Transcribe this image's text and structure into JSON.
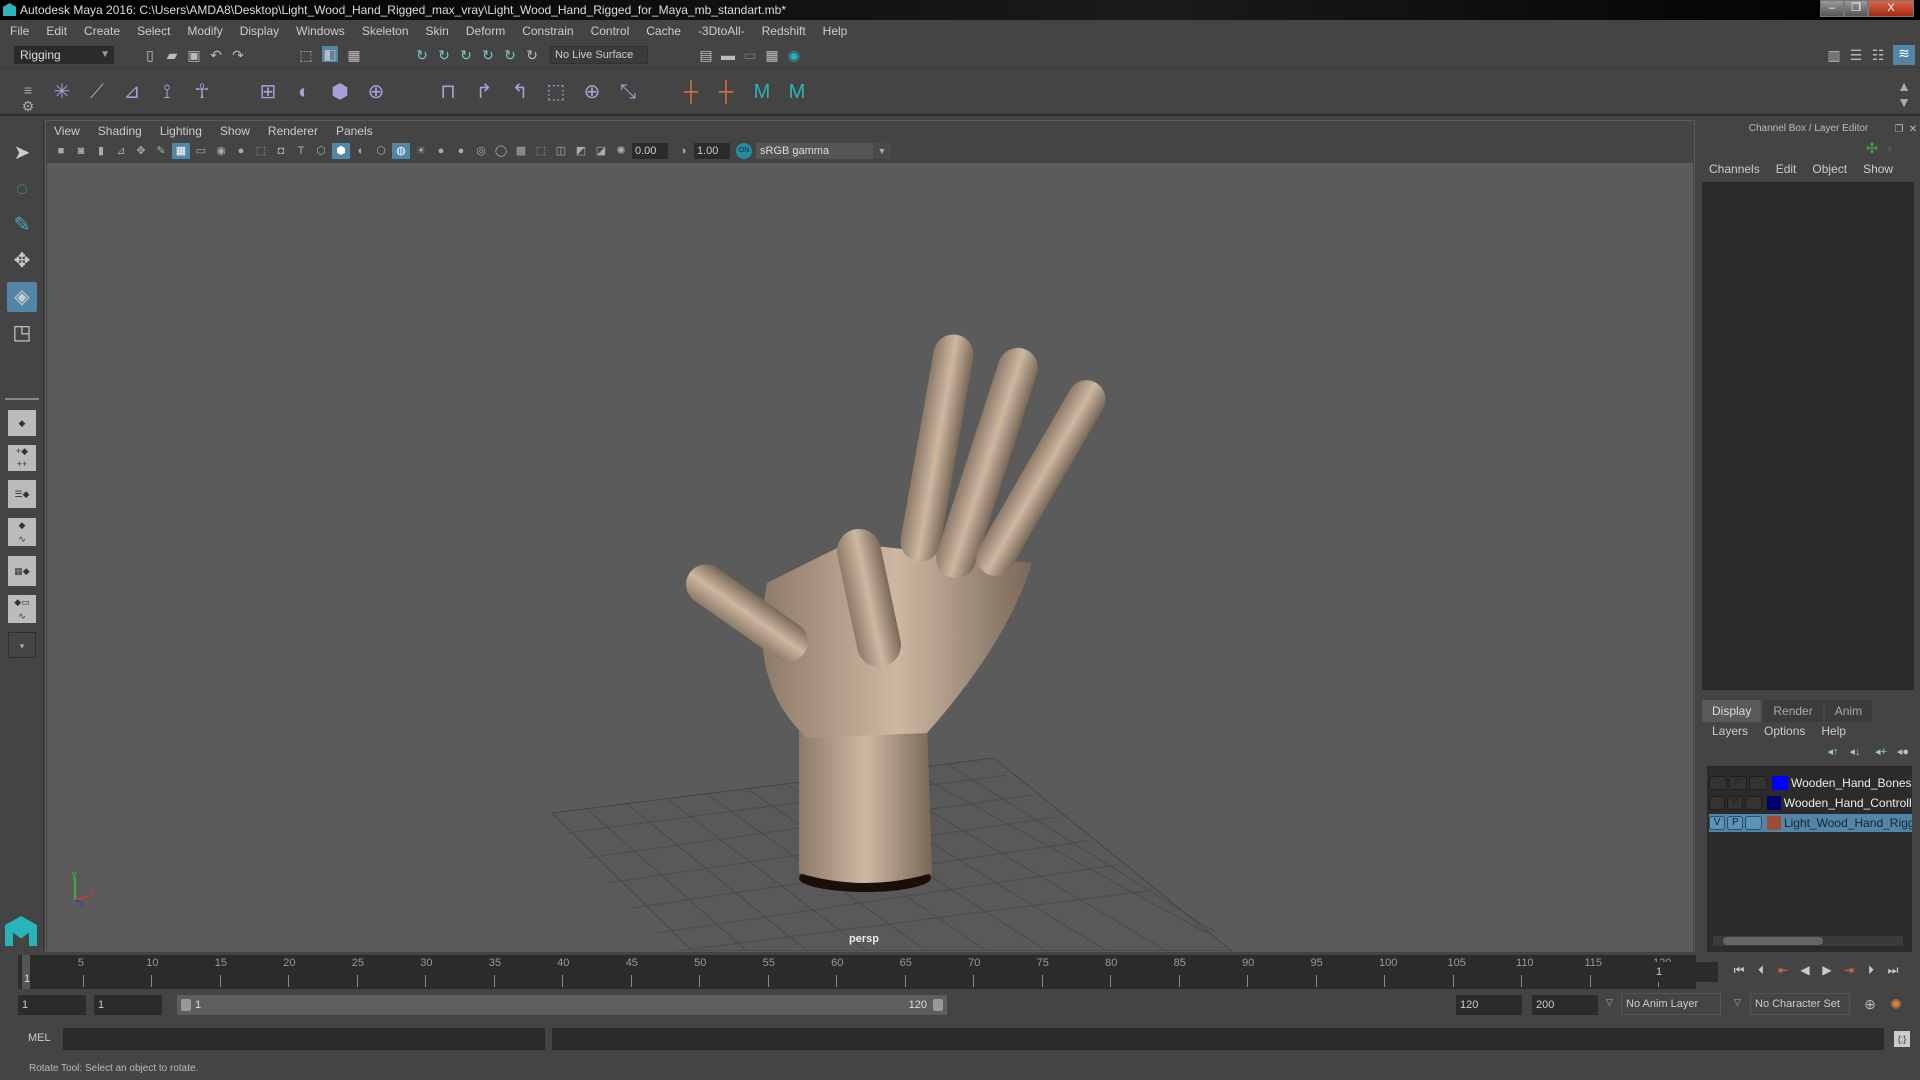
{
  "window": {
    "title": "Autodesk Maya 2016: C:\\Users\\AMDA8\\Desktop\\Light_Wood_Hand_Rigged_max_vray\\Light_Wood_Hand_Rigged_for_Maya_mb_standart.mb*",
    "buttons": {
      "minimize": "–",
      "restore": "❐",
      "close": "X"
    }
  },
  "menubar": [
    "File",
    "Edit",
    "Create",
    "Select",
    "Modify",
    "Display",
    "Windows",
    "Skeleton",
    "Skin",
    "Deform",
    "Constrain",
    "Control",
    "Cache",
    "-3DtoAll-",
    "Redshift",
    "Help"
  ],
  "status_toolbar": {
    "mode": "Rigging",
    "live_surface": "No Live Surface",
    "icons": [
      "new-scene-icon",
      "open-scene-icon",
      "save-scene-icon",
      "undo-icon",
      "redo-icon",
      "select-hierarchy-icon",
      "select-object-icon",
      "select-component-icon",
      "snap-grid-icon",
      "snap-curve-icon",
      "snap-point-icon",
      "snap-projected-center-icon",
      "snap-view-plane-icon",
      "snap-live-icon",
      "render-view-icon",
      "render-icon",
      "ipr-icon",
      "render-settings-icon",
      "hypershade-icon"
    ]
  },
  "shelf": {
    "icons": [
      "joint-tool-icon",
      "insert-joint-icon",
      "ik-handle-icon",
      "ik-spline-icon",
      "humanik-icon",
      "bind-skin-icon",
      "smooth-bind-icon",
      "lattice-icon",
      "cluster-icon",
      "parent-constraint-icon",
      "point-constraint-icon",
      "orient-constraint-icon",
      "scale-constraint-icon",
      "aim-constraint-icon",
      "pole-vector-icon",
      "locator-icon",
      "locator-link-icon",
      "maya-logo-icon",
      "maya-logo-alt-icon"
    ]
  },
  "tools": [
    "select-tool",
    "lasso-tool",
    "paint-select-tool",
    "move-tool",
    "rotate-tool",
    "scale-tool"
  ],
  "viewport": {
    "menu": [
      "View",
      "Shading",
      "Lighting",
      "Show",
      "Renderer",
      "Panels"
    ],
    "exposure": "0.00",
    "gamma": "1.00",
    "color_mgmt_toggle": "ON",
    "color_space": "sRGB gamma",
    "camera_label": "persp",
    "axis": {
      "y": "y",
      "x": "x",
      "z": "z"
    }
  },
  "channel_box": {
    "title": "Channel Box / Layer Editor",
    "menu": [
      "Channels",
      "Edit",
      "Object",
      "Show"
    ]
  },
  "layer_editor": {
    "tabs": [
      "Display",
      "Render",
      "Anim"
    ],
    "active_tab": "Display",
    "menu": [
      "Layers",
      "Options",
      "Help"
    ],
    "layers": [
      {
        "v": "",
        "p": "P",
        "t": "",
        "color": "#0000ff",
        "name": "Wooden_Hand_Bones",
        "selected": false
      },
      {
        "v": "",
        "p": "P",
        "t": "",
        "color": "#00006e",
        "name": "Wooden_Hand_Controllers",
        "selected": false
      },
      {
        "v": "V",
        "p": "P",
        "t": "",
        "color": "#a04a3a",
        "name": "Light_Wood_Hand_Rigged",
        "selected": true
      }
    ]
  },
  "timeline": {
    "ticks": [
      5,
      10,
      15,
      20,
      25,
      30,
      35,
      40,
      45,
      50,
      55,
      60,
      65,
      70,
      75,
      80,
      85,
      90,
      95,
      100,
      105,
      110,
      115,
      120
    ],
    "current_frame_marker": "1",
    "current_frame": "1",
    "range_min": 1,
    "range_max": 120
  },
  "range": {
    "start": "1",
    "playback_start": "1",
    "slider_start": "1",
    "slider_end": "120",
    "playback_end": "120",
    "end": "200",
    "anim_layer": "No Anim Layer",
    "character_set": "No Character Set"
  },
  "command_line": {
    "lang": "MEL",
    "input": "",
    "result": ""
  },
  "status_line": "Rotate Tool: Select an object to rotate."
}
